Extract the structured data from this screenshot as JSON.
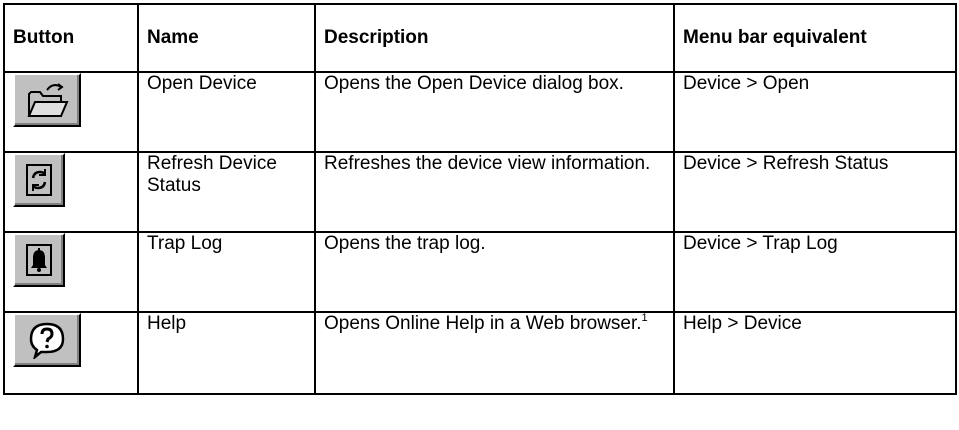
{
  "headers": {
    "button": "Button",
    "name": "Name",
    "description": "Description",
    "menu": "Menu bar equivalent"
  },
  "rows": [
    {
      "icon": "open-folder-icon",
      "name": "Open Device",
      "description": "Opens the Open Device dialog box.",
      "menu": "Device > Open"
    },
    {
      "icon": "refresh-icon",
      "name": "Refresh Device Status",
      "description": "Refreshes the device view information.",
      "menu": "Device > Refresh Status"
    },
    {
      "icon": "bell-icon",
      "name": "Trap Log",
      "description": "Opens the trap log.",
      "menu": "Device > Trap Log"
    },
    {
      "icon": "help-question-icon",
      "name": "Help",
      "description": "Opens Online Help in a Web browser.",
      "footnote": "1",
      "menu": "Help > Device"
    }
  ],
  "colors": {
    "button_face": "#c0c0c0",
    "border": "#000000"
  }
}
